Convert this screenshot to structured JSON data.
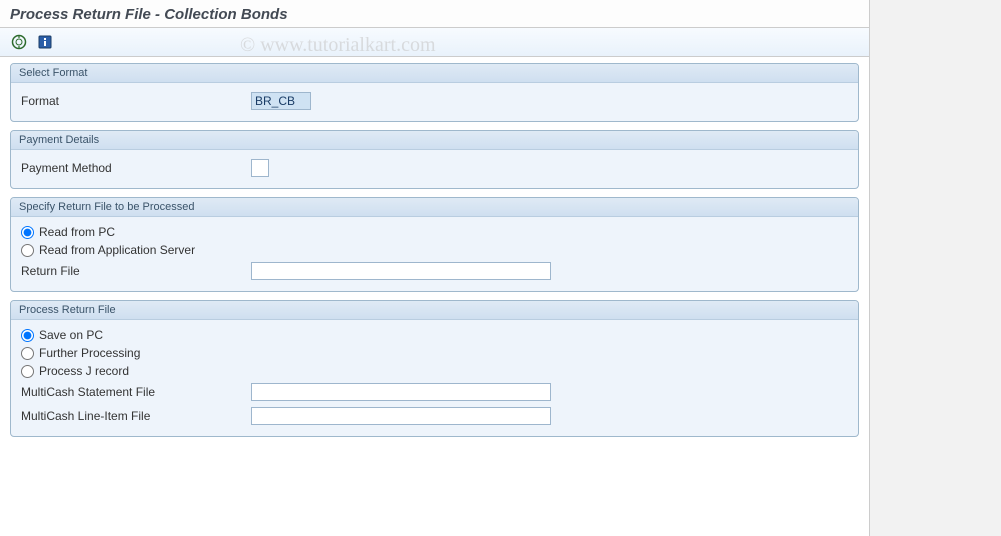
{
  "title": "Process Return File - Collection Bonds",
  "watermark": "© www.tutorialkart.com",
  "toolbar": {
    "execute_tip": "Execute",
    "info_tip": "Information"
  },
  "groups": {
    "select_format": {
      "title": "Select Format",
      "format_label": "Format",
      "format_value": "BR_CB"
    },
    "payment_details": {
      "title": "Payment Details",
      "payment_method_label": "Payment Method",
      "payment_method_value": ""
    },
    "return_file": {
      "title": "Specify Return File to be Processed",
      "read_pc_label": "Read from PC",
      "read_server_label": "Read from Application Server",
      "return_file_label": "Return File",
      "return_file_value": ""
    },
    "process_return": {
      "title": "Process Return File",
      "save_pc_label": "Save on PC",
      "further_label": "Further Processing",
      "jrecord_label": "Process J record",
      "stmt_label": "MultiCash Statement File",
      "stmt_value": "",
      "line_label": "MultiCash Line-Item File",
      "line_value": ""
    }
  }
}
